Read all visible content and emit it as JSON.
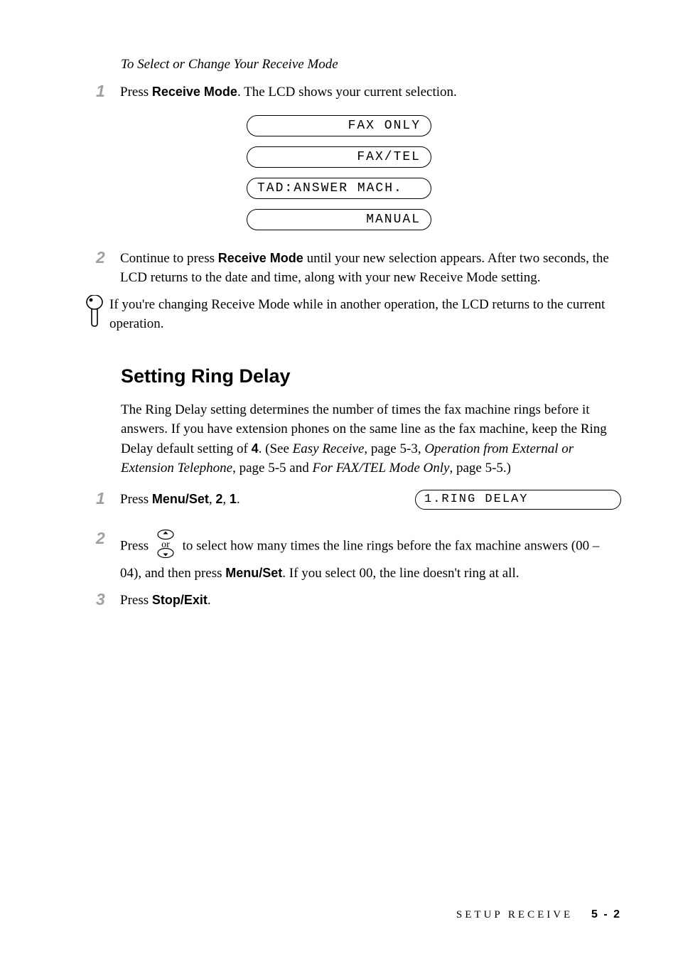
{
  "subhead": "To Select or Change Your Receive Mode",
  "steps_a": {
    "s1_num": "1",
    "s1_pre": "Press ",
    "s1_bold": "Receive Mode",
    "s1_post": ". The LCD shows your current selection.",
    "s2_num": "2",
    "s2_pre": "Continue to press ",
    "s2_bold": "Receive Mode",
    "s2_post": " until your new selection appears. After two seconds, the LCD returns to the date and time, along with your new Receive Mode setting."
  },
  "lcd_opts": {
    "a": "FAX ONLY",
    "b": "FAX/TEL",
    "c": "TAD:ANSWER MACH.",
    "d": "MANUAL"
  },
  "note": "If you're changing Receive Mode while in another operation, the LCD returns to the current operation.",
  "section_heading": "Setting Ring Delay",
  "ring_para_a": "The Ring Delay setting determines the number of times the fax machine rings before it answers.  If you have extension phones on the same line as the fax machine, keep the Ring Delay default setting of ",
  "ring_para_bold4": "4",
  "ring_para_b": ". (See ",
  "ring_cite1": "Easy Receive",
  "ring_para_c": ", page 5-3, ",
  "ring_cite2": "Operation from External or Extension Telephone",
  "ring_para_d": ", page 5-5 and ",
  "ring_cite3": "For FAX/TEL Mode Only",
  "ring_para_e": ", page 5-5.)",
  "steps_b": {
    "s1_num": "1",
    "s1_pre": "Press ",
    "s1_bold1": "Menu/Set",
    "s1_mid1": ", ",
    "s1_bold2": "2",
    "s1_mid2": ", ",
    "s1_bold3": "1",
    "s1_post": ".",
    "s1_lcd": "1.RING DELAY",
    "s2_num": "2",
    "s2_pre": "Press ",
    "s2_or": "or",
    "s2_mid": "  to select how many times the line rings before the fax machine answers (00 – 04), and then press ",
    "s2_bold": "Menu/Set",
    "s2_post": ". If you select 00, the line doesn't ring at all.",
    "s3_num": "3",
    "s3_pre": "Press ",
    "s3_bold": "Stop/Exit",
    "s3_post": "."
  },
  "footer_section": "SETUP RECEIVE",
  "footer_page": "5 - 2"
}
